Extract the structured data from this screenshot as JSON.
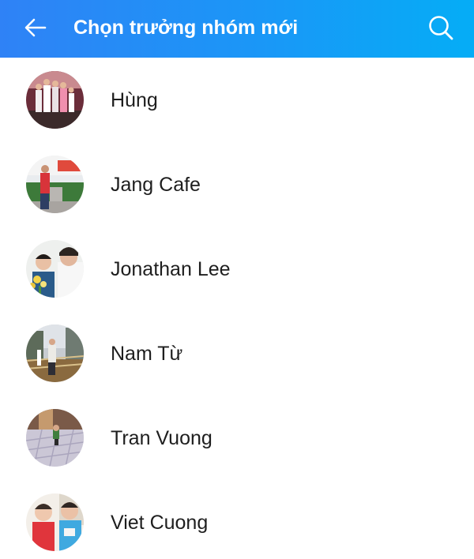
{
  "header": {
    "title": "Chọn trưởng nhóm mới",
    "back_icon": "arrow-left-icon",
    "search_icon": "search-icon",
    "background_from": "#2f82f6",
    "background_to": "#05adf6"
  },
  "contacts": [
    {
      "name": "Hùng"
    },
    {
      "name": "Jang Cafe"
    },
    {
      "name": "Jonathan Lee"
    },
    {
      "name": "Nam Từ"
    },
    {
      "name": "Tran Vuong"
    },
    {
      "name": "Viet Cuong"
    }
  ]
}
